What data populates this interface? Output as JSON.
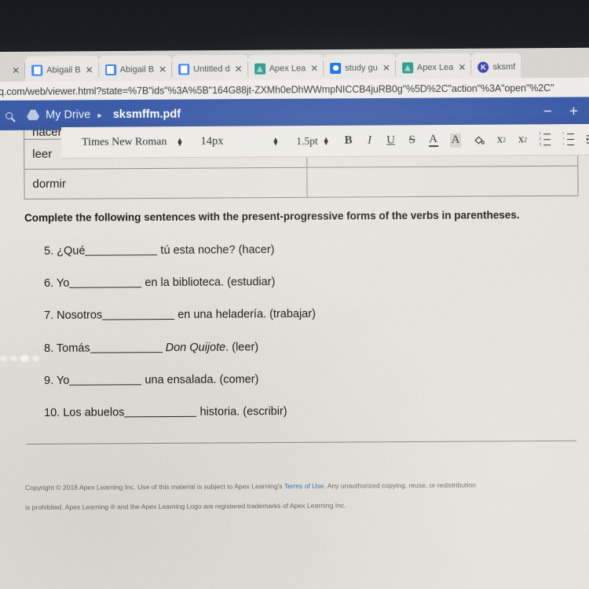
{
  "browser": {
    "tabs": [
      {
        "title": "",
        "favicon": "none-icon",
        "close": "✕",
        "first": true
      },
      {
        "title": "Abigail B",
        "favicon": "google-docs-icon",
        "close": "✕"
      },
      {
        "title": "Abigail B",
        "favicon": "google-docs-icon",
        "close": "✕"
      },
      {
        "title": "Untitled d",
        "favicon": "google-docs-icon",
        "close": "✕"
      },
      {
        "title": "Apex Lea",
        "favicon": "apex-learning-icon",
        "close": "✕"
      },
      {
        "title": "study gu",
        "favicon": "google-slides-icon",
        "close": "✕"
      },
      {
        "title": "Apex Lea",
        "favicon": "apex-learning-icon",
        "close": "✕"
      },
      {
        "title": "sksmf",
        "favicon": "kami-icon",
        "close": ""
      }
    ],
    "url": "q.com/web/viewer.html?state=%7B\"ids\"%3A%5B\"164G88jt-ZXMh0eDhWWmpNICCB4juRB0g\"%5D%2C\"action\"%3A\"open\"%2C\""
  },
  "drive_header": {
    "search_icon": "search-icon",
    "drive_icon": "google-drive-icon",
    "my_drive_label": "My Drive",
    "separator": "▸",
    "file_name": "sksmffm.pdf",
    "zoom_out": "−",
    "zoom_in": "+"
  },
  "doc_toolbar": {
    "font_family": "Times New Roman",
    "font_size": "14px",
    "line_spacing": "1.5pt",
    "stepper_up": "▲",
    "stepper_down": "▼",
    "bold": "B",
    "italic": "I",
    "underline": "U",
    "strikethrough": "S",
    "text_color": "A",
    "highlight": "A",
    "fill_color": "fill-bucket-icon",
    "subscript_base": "x",
    "subscript_index": "2",
    "superscript_base": "x",
    "superscript_index": "2",
    "numbered_list": "numbered-list-icon",
    "bulleted_list": "bulleted-list-icon",
    "indent": "indent-icon"
  },
  "document": {
    "table_rows": [
      {
        "verb": "hacer",
        "answer": ""
      },
      {
        "verb": "leer",
        "answer": ""
      },
      {
        "verb": "dormir",
        "answer": ""
      }
    ],
    "instruction": "Complete the following sentences with the present-progressive forms of the verbs in parentheses.",
    "questions": [
      {
        "number": "5.",
        "before": "¿Qué",
        "after": "tú esta noche? (hacer)",
        "italic": ""
      },
      {
        "number": "6.",
        "before": "Yo",
        "after": "en la biblioteca. (estudiar)",
        "italic": ""
      },
      {
        "number": "7.",
        "before": "Nosotros",
        "after": "en una heladería. (trabajar)",
        "italic": ""
      },
      {
        "number": "8.",
        "before": "Tomás",
        "after": ". (leer)",
        "italic": "Don Quijote"
      },
      {
        "number": "9.",
        "before": "Yo",
        "after": "una ensalada. (comer)",
        "italic": ""
      },
      {
        "number": "10.",
        "before": "Los abuelos",
        "after": "historia. (escribir)",
        "italic": ""
      }
    ],
    "footer_line1_a": "Copyright © 2018 Apex Learning Inc. Use of this material is subject to Apex Learning's ",
    "footer_terms": "Terms of Use",
    "footer_line1_b": ". Any unauthorized copying, reuse, or redistribution",
    "footer_line2": "is prohibited. Apex Learning ® and the Apex Learning Logo are registered trademarks of Apex Learning Inc."
  },
  "colors": {
    "drive_blue": "#3b5ba8",
    "link_blue": "#2f6fc4",
    "page_bg": "#e6e3dc",
    "bezel": "#15181d"
  }
}
